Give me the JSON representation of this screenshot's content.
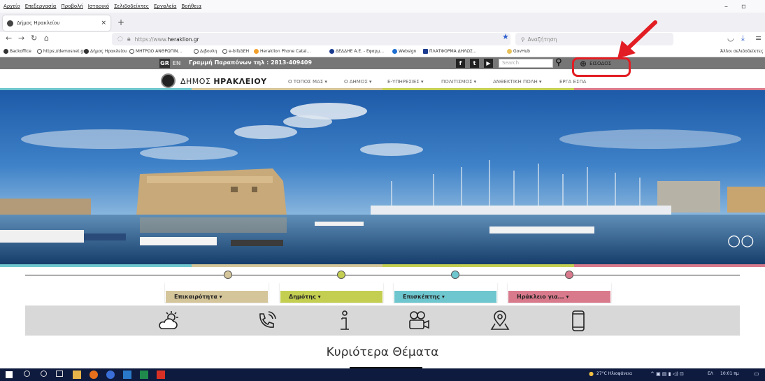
{
  "browser": {
    "menu": [
      "Αρχείο",
      "Επεξεργασία",
      "Προβολή",
      "Ιστορικό",
      "Σελιδοδείκτες",
      "Εργαλεία",
      "Βοήθεια"
    ],
    "tab_title": "Δήμος Ηρακλείου",
    "url_prefix": "https://www.",
    "url_domain": "heraklion.gr",
    "search_placeholder": "Αναζήτηση",
    "bookmarks": [
      "Backoffice",
      "https://demosnet.gr/",
      "Δήμος Ηρακλείου",
      "ΜΗΤΡΩΟ ΑΝΘΡΩΠΙΝ...",
      "Διβουλη",
      "e-bill/ΔΕΗ",
      "Heraklion Phone Catal...",
      "ΔΕΔΔΗΕ Α.Ε. - Εφαρμ...",
      "Websign",
      "ΠΛΑΤΦΟΡΜΑ ΔΗΛΩΣ...",
      "GovHub"
    ],
    "other_bookmarks": "Άλλοι σελιδοδείκτες"
  },
  "site": {
    "lang_gr": "GR",
    "lang_en": "EN",
    "hotline": "Γραμμή Παραπόνων τηλ : 2813-409409",
    "search_placeholder": "Search",
    "login": "ΕΙΣΟΔΟΣ",
    "brand_light": "ΔΗΜΟΣ ",
    "brand_bold": "ΗΡΑΚΛΕΙΟΥ",
    "nav": [
      "Ο ΤΟΠΟΣ ΜΑΣ ▾",
      "Ο ΔΗΜΟΣ ▾",
      "Ε-ΥΠΗΡΕΣΙΕΣ ▾",
      "ΠΟΛΙΤΙΣΜΟΣ ▾",
      "ΑΝΘΕΚΤΙΚΗ ΠΟΛΗ ▾",
      "ΕΡΓΑ ΕΣΠΑ"
    ],
    "categories": [
      "Επικαιρότητα ▾",
      "Δημότης ▾",
      "Επισκέπτης ▾",
      "Ηράκλειο για... ▾"
    ],
    "heading": "Κυριότερα Θέματα"
  },
  "taskbar": {
    "weather": "27°C Ηλιοφάνεια",
    "lang": "ΕΛ",
    "time": "10:01 πμ"
  },
  "colors": {
    "blue": "#6ec6ce",
    "tan": "#d4c59a",
    "green": "#c4cf52",
    "pink": "#d97a8c",
    "highlight": "#e21d23"
  }
}
